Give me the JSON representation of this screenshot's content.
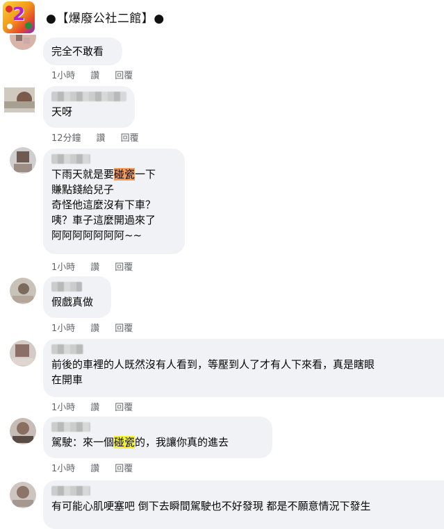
{
  "header": {
    "title": "●【爆廢公社二館】●",
    "logo_text": "2"
  },
  "comments": [
    {
      "text": "完全不敢看",
      "time": "1小時",
      "like": "讚",
      "reply": "回覆"
    },
    {
      "text": "天呀",
      "time": "12分鐘",
      "like": "讚",
      "reply": "回覆"
    },
    {
      "text_before": "下雨天就是要",
      "highlight": "碰瓷",
      "text_after": "一下\n賺點錢給兒子\n奇怪他這麼沒有下車？\n咦？車子這麼開過來了\n阿阿阿阿阿阿阿~~",
      "time": "1小時",
      "like": "讚",
      "reply": "回覆"
    },
    {
      "text": "假戲真做",
      "time": "1小時",
      "like": "讚",
      "reply": "回覆"
    },
    {
      "text": "前後的車裡的人既然沒有人看到，等壓到人了才有人下來看，真是瞎眼\n在開車",
      "time": "1小時",
      "like": "讚",
      "reply": "回覆"
    },
    {
      "text_before": "駕駛：來一個",
      "highlight": "碰瓷",
      "text_after": "的，我讓你真的進去",
      "time": "1小時",
      "like": "讚",
      "reply": "回覆"
    },
    {
      "text": "有可能心肌哽塞吧 倒下去瞬間駕駛也不好發現 都是不願意情況下發生"
    }
  ],
  "colors": {
    "bubble": "#f0f2f5",
    "meta_text": "#65676b",
    "highlight_orange": "#f39c5a",
    "highlight_yellow": "#f6ef3a"
  }
}
